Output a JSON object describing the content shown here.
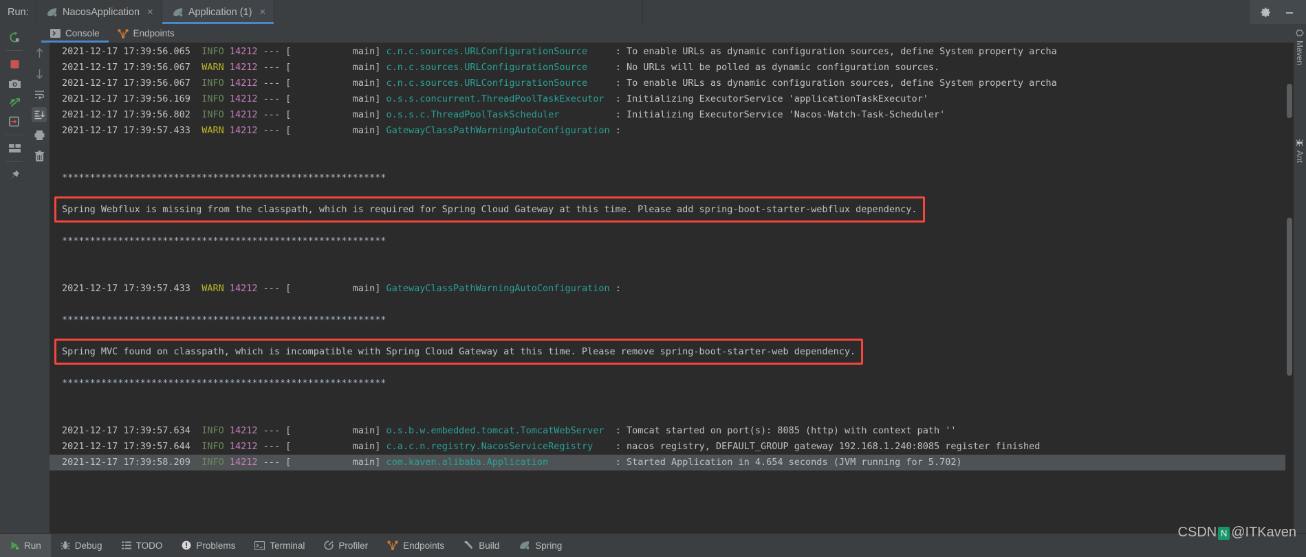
{
  "window": {
    "run_label": "Run:",
    "settings_icon": "gear-icon",
    "minimize_icon": "minimize-icon"
  },
  "run_tabs": [
    {
      "label": "NacosApplication",
      "icon": "spring-leaf-icon",
      "close": "×",
      "active": false
    },
    {
      "label": "Application (1)",
      "icon": "spring-leaf-icon",
      "close": "×",
      "active": true
    }
  ],
  "console_tabs": [
    {
      "label": "Console",
      "icon": "console-icon",
      "active": true
    },
    {
      "label": "Endpoints",
      "icon": "endpoints-icon",
      "active": false
    }
  ],
  "left_toolbar": [
    {
      "name": "rerun-icon",
      "title": "Rerun"
    },
    {
      "name": "stop-icon",
      "title": "Stop"
    },
    {
      "name": "camera-icon",
      "title": "Screenshot"
    },
    {
      "name": "thread-dump-icon",
      "title": "Thread Dump"
    },
    {
      "name": "exit-icon",
      "title": "Exit"
    },
    {
      "name": "layout-icon",
      "title": "Layout"
    },
    {
      "name": "pin-icon",
      "title": "Pin Tab"
    }
  ],
  "gutter_icons": [
    {
      "name": "arrow-up-icon",
      "title": "Up the stack trace"
    },
    {
      "name": "arrow-down-icon",
      "title": "Down the stack trace"
    },
    {
      "name": "soft-wrap-icon",
      "title": "Use Soft Wraps"
    },
    {
      "name": "scroll-to-end-icon",
      "title": "Scroll to the end",
      "selected": true
    },
    {
      "name": "print-icon",
      "title": "Print"
    },
    {
      "name": "trash-icon",
      "title": "Clear All"
    }
  ],
  "right_strip": [
    {
      "label": "Maven",
      "icon": "maven-icon"
    },
    {
      "label": "Ant",
      "icon": "ant-icon"
    }
  ],
  "status_bar": [
    {
      "label": "Run",
      "icon": "run-icon",
      "active": true
    },
    {
      "label": "Debug",
      "icon": "debug-icon",
      "active": false
    },
    {
      "label": "TODO",
      "icon": "todo-icon",
      "active": false
    },
    {
      "label": "Problems",
      "icon": "problems-icon",
      "active": false
    },
    {
      "label": "Terminal",
      "icon": "terminal-icon",
      "active": false
    },
    {
      "label": "Profiler",
      "icon": "profiler-icon",
      "active": false
    },
    {
      "label": "Endpoints",
      "icon": "endpoints-icon",
      "active": false
    },
    {
      "label": "Build",
      "icon": "build-icon",
      "active": false
    },
    {
      "label": "Spring",
      "icon": "spring-leaf-icon",
      "active": false
    }
  ],
  "watermark": {
    "prefix": "CSDN",
    "badge": "N",
    "suffix": "@ITKaven"
  },
  "colors": {
    "accent_blue": "#4a88c7",
    "highlight_red": "#f5453c",
    "log_bg": "#2b2b2b",
    "panel_bg": "#3c3f41",
    "info_green": "#6a8759",
    "warn_yellow": "#bbb529",
    "pid_magenta": "#c77dbb",
    "class_cyan": "#2aa198",
    "text_grey": "#bfc2c5"
  },
  "console_log": [
    {
      "type": "entry",
      "ts": "2021-12-17 17:39:56.065",
      "level": "INFO",
      "pid": "14212",
      "thread": "main",
      "logger": "c.n.c.sources.URLConfigurationSource",
      "message": "To enable URLs as dynamic configuration sources, define System property archa"
    },
    {
      "type": "entry",
      "ts": "2021-12-17 17:39:56.067",
      "level": "WARN",
      "pid": "14212",
      "thread": "main",
      "logger": "c.n.c.sources.URLConfigurationSource",
      "message": "No URLs will be polled as dynamic configuration sources."
    },
    {
      "type": "entry",
      "ts": "2021-12-17 17:39:56.067",
      "level": "INFO",
      "pid": "14212",
      "thread": "main",
      "logger": "c.n.c.sources.URLConfigurationSource",
      "message": "To enable URLs as dynamic configuration sources, define System property archa"
    },
    {
      "type": "entry",
      "ts": "2021-12-17 17:39:56.169",
      "level": "INFO",
      "pid": "14212",
      "thread": "main",
      "logger": "o.s.s.concurrent.ThreadPoolTaskExecutor",
      "message": "Initializing ExecutorService 'applicationTaskExecutor'"
    },
    {
      "type": "entry",
      "ts": "2021-12-17 17:39:56.802",
      "level": "INFO",
      "pid": "14212",
      "thread": "main",
      "logger": "o.s.s.c.ThreadPoolTaskScheduler",
      "message": "Initializing ExecutorService 'Nacos-Watch-Task-Scheduler'"
    },
    {
      "type": "entry",
      "ts": "2021-12-17 17:39:57.433",
      "level": "WARN",
      "pid": "14212",
      "thread": "main",
      "logger": "GatewayClassPathWarningAutoConfiguration",
      "message": ""
    },
    {
      "type": "blank"
    },
    {
      "type": "blank"
    },
    {
      "type": "stars",
      "text": "**********************************************************"
    },
    {
      "type": "blank"
    },
    {
      "type": "plain",
      "text": "Spring Webflux is missing from the classpath, which is required for Spring Cloud Gateway at this time. Please add spring-boot-starter-webflux dependency.",
      "highlight": true
    },
    {
      "type": "blank"
    },
    {
      "type": "stars",
      "text": "**********************************************************"
    },
    {
      "type": "blank"
    },
    {
      "type": "blank"
    },
    {
      "type": "entry",
      "ts": "2021-12-17 17:39:57.433",
      "level": "WARN",
      "pid": "14212",
      "thread": "main",
      "logger": "GatewayClassPathWarningAutoConfiguration",
      "message": ""
    },
    {
      "type": "blank"
    },
    {
      "type": "stars",
      "text": "**********************************************************"
    },
    {
      "type": "blank"
    },
    {
      "type": "plain",
      "text": "Spring MVC found on classpath, which is incompatible with Spring Cloud Gateway at this time. Please remove spring-boot-starter-web dependency.",
      "highlight": true
    },
    {
      "type": "blank"
    },
    {
      "type": "stars",
      "text": "**********************************************************"
    },
    {
      "type": "blank"
    },
    {
      "type": "blank"
    },
    {
      "type": "entry",
      "ts": "2021-12-17 17:39:57.634",
      "level": "INFO",
      "pid": "14212",
      "thread": "main",
      "logger": "o.s.b.w.embedded.tomcat.TomcatWebServer",
      "message": "Tomcat started on port(s): 8085 (http) with context path ''"
    },
    {
      "type": "entry",
      "ts": "2021-12-17 17:39:57.644",
      "level": "INFO",
      "pid": "14212",
      "thread": "main",
      "logger": "c.a.c.n.registry.NacosServiceRegistry",
      "message": "nacos registry, DEFAULT_GROUP gateway 192.168.1.240:8085 register finished"
    },
    {
      "type": "entry",
      "ts": "2021-12-17 17:39:58.209",
      "level": "INFO",
      "pid": "14212",
      "thread": "main",
      "logger": "com.kaven.alibaba.Application",
      "message": "Started Application in 4.654 seconds (JVM running for 5.702)",
      "selected": true
    }
  ]
}
